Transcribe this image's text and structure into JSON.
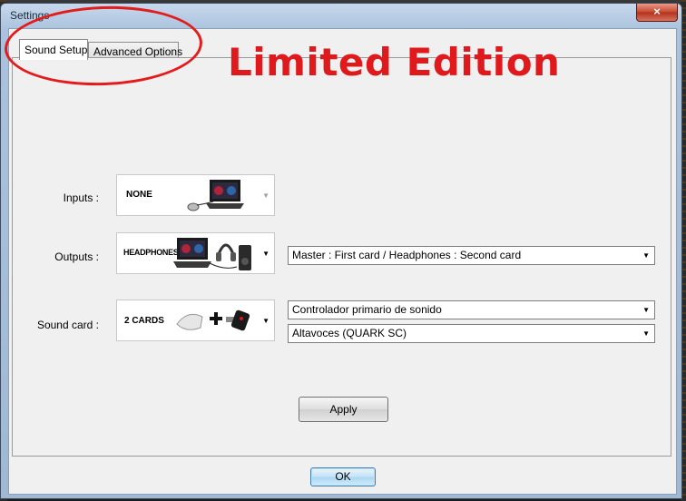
{
  "window": {
    "title": "Settings",
    "close_glyph": "×"
  },
  "tabs": [
    {
      "label": "Sound Setup",
      "active": true
    },
    {
      "label": "Advanced Options",
      "active": false
    }
  ],
  "annotation": {
    "text": "Limited Edition",
    "color": "#e0191c"
  },
  "inputs": {
    "label": "Inputs :",
    "image_caption": "NONE"
  },
  "outputs": {
    "label": "Outputs :",
    "image_caption": "HEADPHONES",
    "selected": "Master : First card / Headphones : Second card"
  },
  "sound_card": {
    "label": "Sound card :",
    "image_caption": "2 CARDS",
    "card1_selected": "Controlador primario de sonido",
    "card2_selected": "Altavoces (QUARK SC)"
  },
  "buttons": {
    "apply": "Apply",
    "ok": "OK"
  },
  "dropdown_glyph": "▼"
}
